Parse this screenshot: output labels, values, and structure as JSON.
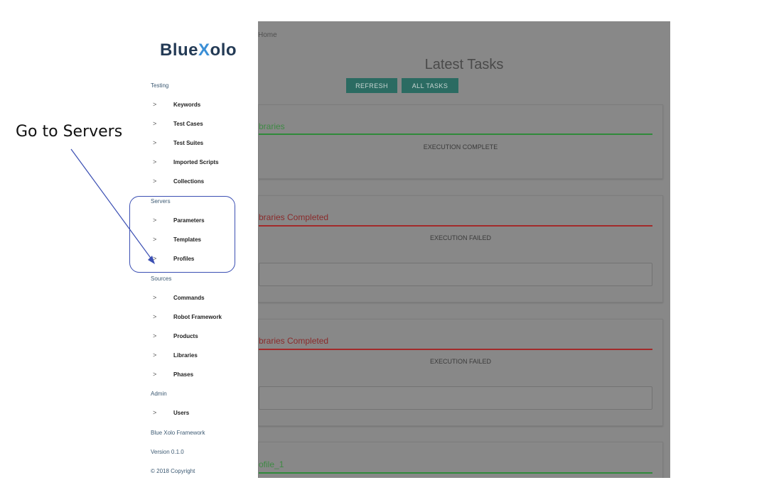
{
  "annotation": {
    "label": "Go to Servers"
  },
  "sidebar": {
    "logo": {
      "part1": "Blue",
      "part2": "X",
      "part3": "olo"
    },
    "sections": [
      {
        "label": "Testing",
        "items": [
          "Keywords",
          "Test Cases",
          "Test Suites",
          "Imported Scripts",
          "Collections"
        ]
      },
      {
        "label": "Servers",
        "items": [
          "Parameters",
          "Templates",
          "Profiles"
        ]
      },
      {
        "label": "Sources",
        "items": [
          "Commands",
          "Robot Framework",
          "Products",
          "Libraries",
          "Phases"
        ]
      },
      {
        "label": "Admin",
        "items": [
          "Users"
        ]
      }
    ],
    "footer": {
      "framework": "Blue Xolo Framework",
      "version": "Version 0.1.0",
      "copyright": "© 2018 Copyright"
    }
  },
  "main": {
    "breadcrumb": "Home",
    "title": "Latest Tasks",
    "buttons": {
      "refresh": "REFRESH",
      "all_tasks": "ALL TASKS"
    },
    "cards": [
      {
        "title": "braries",
        "status": "EXECUTION COMPLETE",
        "state": "green"
      },
      {
        "title": "braries Completed",
        "status": "EXECUTION FAILED",
        "state": "red"
      },
      {
        "title": "braries Completed",
        "status": "EXECUTION FAILED",
        "state": "red"
      },
      {
        "title": "ofile_1",
        "status": "",
        "state": "green"
      }
    ]
  }
}
